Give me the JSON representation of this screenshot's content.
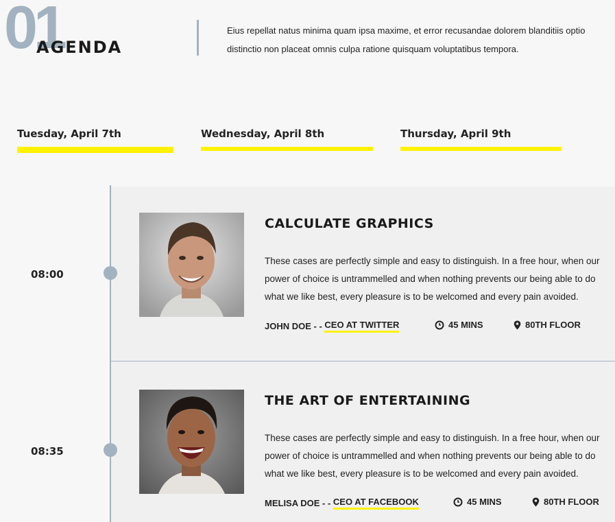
{
  "header": {
    "number": "01",
    "title": "AGENDA",
    "intro": [
      "Eius repellat natus minima quam ipsa maxime, et error recusandae dolorem blanditiis optio",
      "distinctio non placeat omnis culpa ratione quisquam voluptatibus tempora."
    ]
  },
  "tabs": [
    {
      "label": "Tuesday, April 7th"
    },
    {
      "label": "Wednesday, April 8th"
    },
    {
      "label": "Thursday, April 9th"
    }
  ],
  "sessions": [
    {
      "time": "08:00",
      "title": "CALCULATE GRAPHICS",
      "description": [
        "These cases are perfectly simple and easy to distinguish. In a free hour, when our",
        "power of choice is untrammelled and when nothing prevents our being able to do",
        "what we like best, every pleasure is to be welcomed and every pain avoided."
      ],
      "speaker": "JOHN DOE - - ",
      "role": "CEO AT TWITTER",
      "duration": "45 MINS",
      "location": "80TH FLOOR",
      "photo_icon": "portrait-man-smiling"
    },
    {
      "time": "08:35",
      "title": "THE ART OF ENTERTAINING",
      "description": [
        "These cases are perfectly simple and easy to distinguish. In a free hour, when our",
        "power of choice is untrammelled and when nothing prevents our being able to do",
        "what we like best, every pleasure is to be welcomed and every pain avoided."
      ],
      "speaker": "MELISA DOE - - ",
      "role": "CEO AT FACEBOOK",
      "duration": "45 MINS",
      "location": "80TH FLOOR",
      "photo_icon": "portrait-man-laughing"
    }
  ],
  "colors": {
    "accent": "#fff200",
    "timeline": "#a3b2c0",
    "card": "#f0f0f0",
    "background": "#f7f7f7"
  }
}
